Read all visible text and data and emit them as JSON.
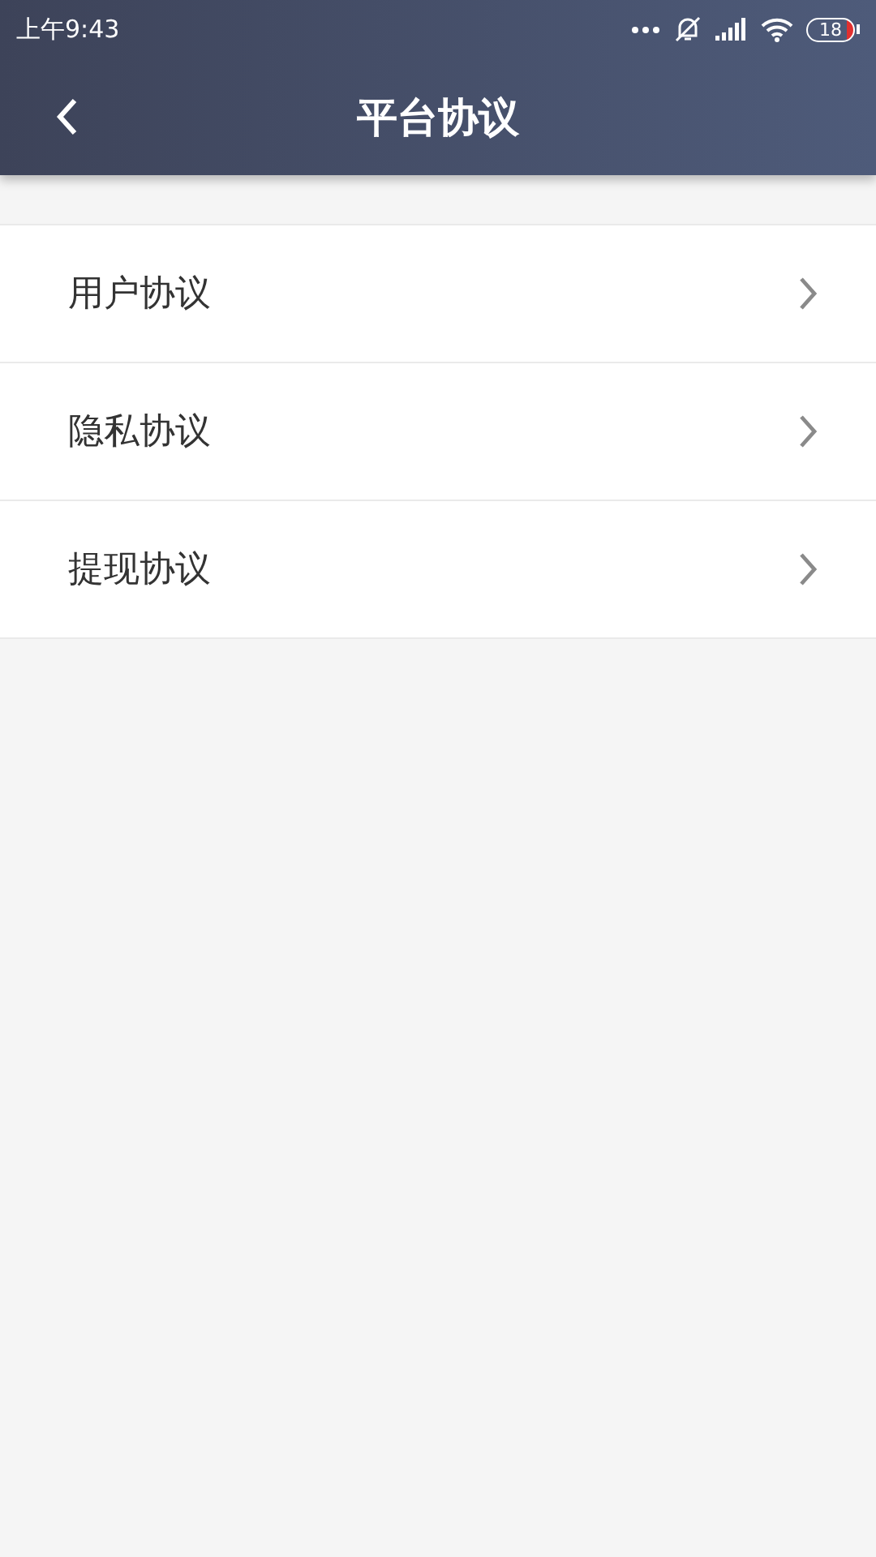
{
  "status_bar": {
    "time": "上午9:43",
    "battery": "18"
  },
  "header": {
    "title": "平台协议"
  },
  "items": [
    {
      "label": "用户协议"
    },
    {
      "label": "隐私协议"
    },
    {
      "label": "提现协议"
    }
  ]
}
